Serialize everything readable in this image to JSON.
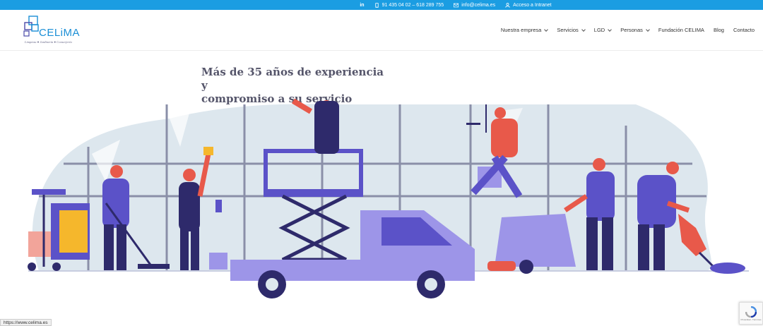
{
  "topbar": {
    "linkedin": "in",
    "phone": "91 435 04 02 – 618 289 755",
    "email": "info@celima.es",
    "intranet": "Acceso a Intranet",
    "color": "#1b9de2"
  },
  "logo": {
    "name": "CELiMA",
    "tagline": "Limpieza ● Jardinería ● Conserjería",
    "color": "#1b8fd6"
  },
  "nav": [
    {
      "label": "Nuestra empresa",
      "dropdown": true
    },
    {
      "label": "Servicios",
      "dropdown": true
    },
    {
      "label": "LGD",
      "dropdown": true
    },
    {
      "label": "Personas",
      "dropdown": true
    },
    {
      "label": "Fundación CELIMA",
      "dropdown": false
    },
    {
      "label": "Blog",
      "dropdown": false
    },
    {
      "label": "Contacto",
      "dropdown": false
    }
  ],
  "hero": {
    "title_line1": "Más de 35 años de experiencia y",
    "title_line2": "compromiso a su servicio"
  },
  "illustration": {
    "icon": "cleaning-crew-illustration",
    "colors": {
      "purple": "#5b52c8",
      "dark": "#2e2a6b",
      "skin": "#e8594a",
      "glass": "#dde7ee",
      "truck": "#9d95e8"
    }
  },
  "status_url": "https://www.celima.es",
  "recaptcha": {
    "label": "Privacidad - Términos"
  }
}
